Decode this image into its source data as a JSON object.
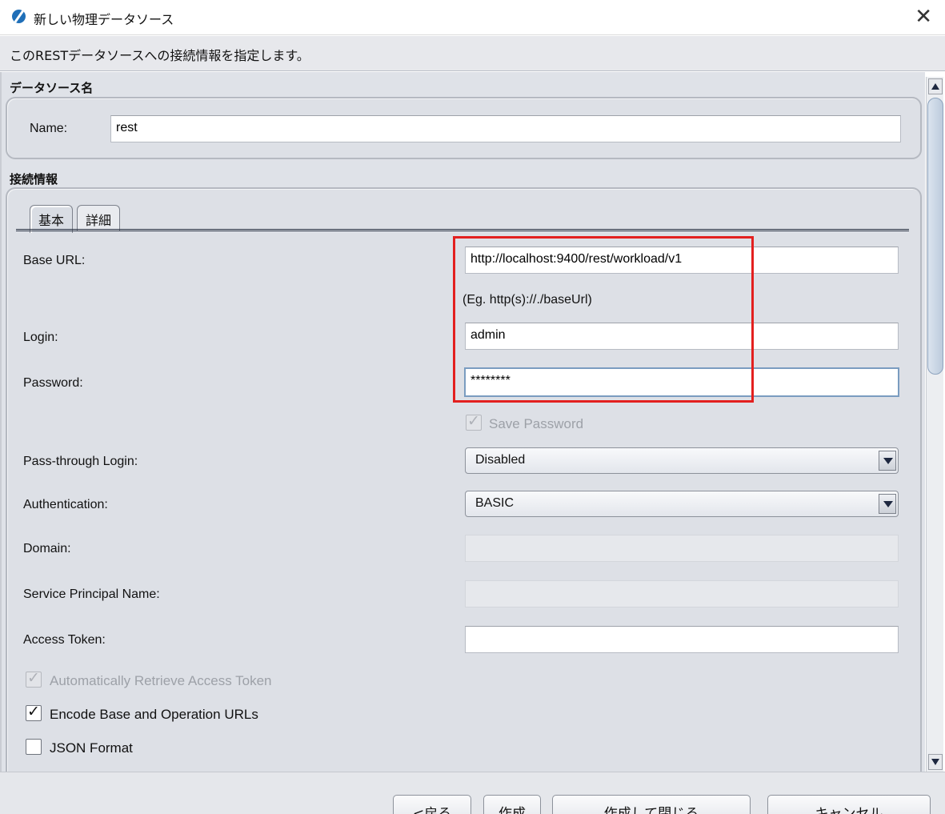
{
  "window": {
    "title": "新しい物理データソース",
    "subtitle": "このRESTデータソースへの接続情報を指定します。"
  },
  "datasource_section": {
    "title": "データソース名",
    "name_label": "Name:",
    "name_value": "rest"
  },
  "connection_section": {
    "title": "接続情報",
    "tabs": [
      {
        "label": "基本",
        "active": true
      },
      {
        "label": "詳細",
        "active": false
      }
    ]
  },
  "form": {
    "base_url_label": "Base URL:",
    "base_url_value": "http://localhost:9400/rest/workload/v1",
    "base_url_hint": "(Eg. http(s)://./baseUrl)",
    "login_label": "Login:",
    "login_value": "admin",
    "password_label": "Password:",
    "password_value": "********",
    "save_password_label": "Save Password",
    "pass_through_label": "Pass-through Login:",
    "pass_through_value": "Disabled",
    "authentication_label": "Authentication:",
    "authentication_value": "BASIC",
    "domain_label": "Domain:",
    "domain_value": "",
    "spn_label": "Service Principal Name:",
    "spn_value": "",
    "access_token_label": "Access Token:",
    "access_token_value": "",
    "auto_retrieve_label": "Automatically Retrieve Access Token",
    "encode_urls_label": "Encode Base and Operation URLs",
    "json_format_label": "JSON Format"
  },
  "checkbox_states": {
    "save_password": true,
    "auto_retrieve": true,
    "encode_urls": true,
    "json_format": false
  },
  "footer": {
    "back_label": "<戻る",
    "create_label": "作成",
    "create_close_label": "作成して閉じる",
    "cancel_label": "キャンセル"
  },
  "colors": {
    "highlight_box": "#e3201f",
    "panel_background": "#dfe2e8",
    "app_icon": "#1f6fb8"
  },
  "icons": {
    "app": "app-logo-icon",
    "close": "close-icon",
    "check": "checkmark-icon",
    "dropdown": "chevron-down-icon"
  }
}
